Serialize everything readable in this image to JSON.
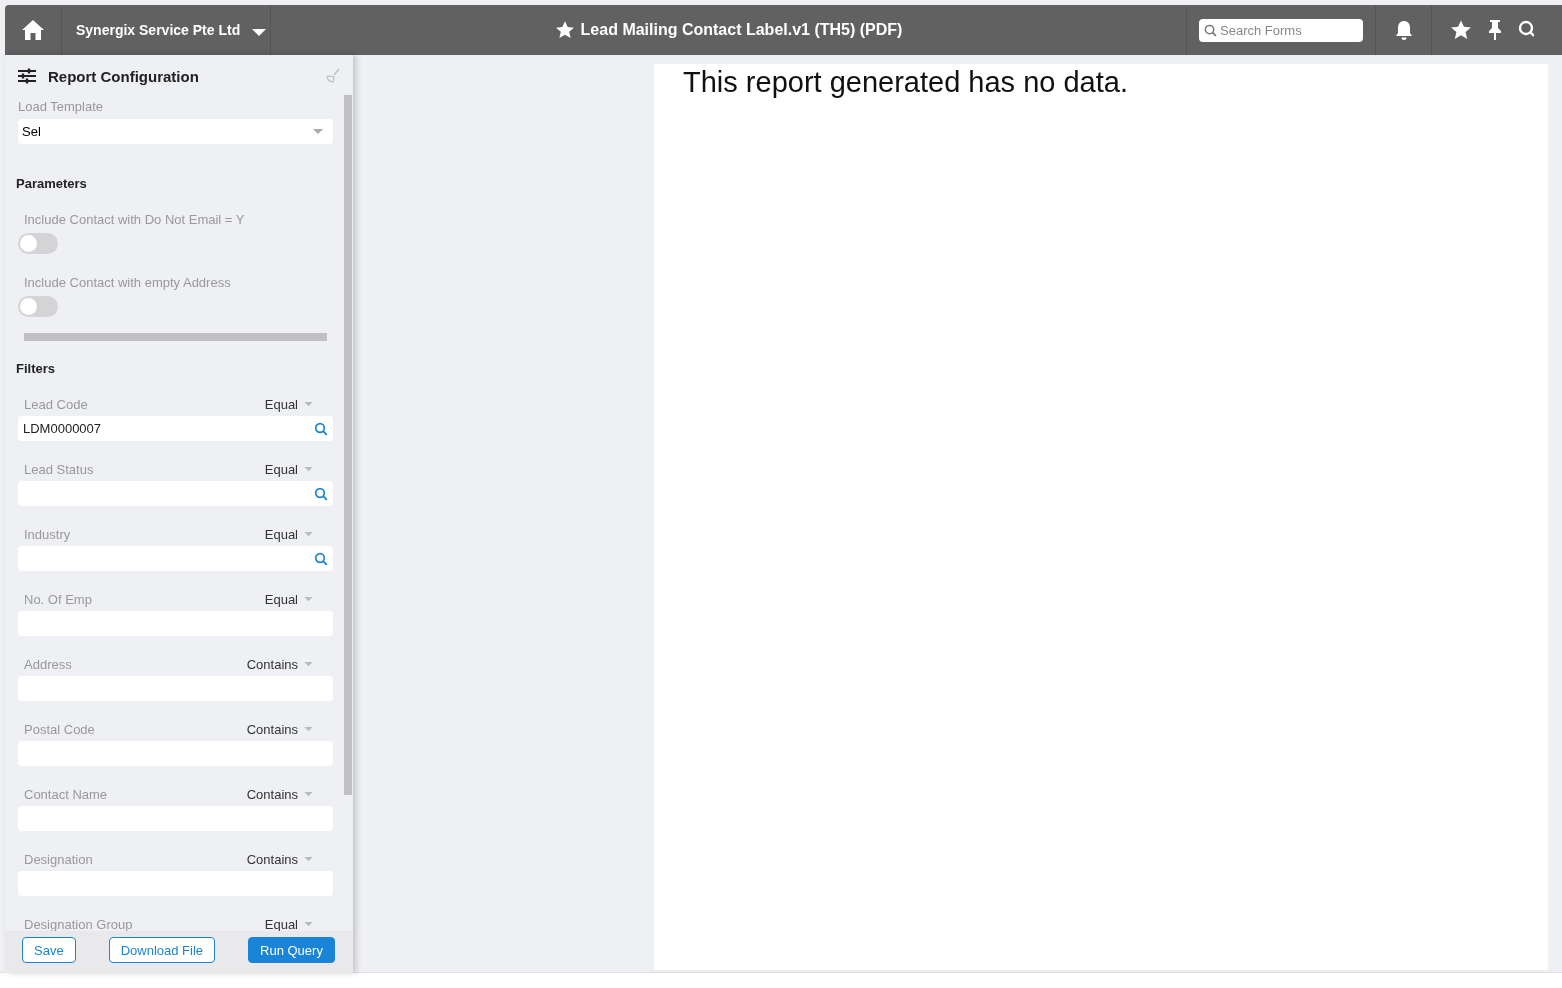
{
  "header": {
    "company": "Synergix Service Pte Ltd",
    "title": "Lead Mailing Contact Label.v1 (TH5) (PDF)",
    "search": {
      "placeholder": "Search Forms"
    }
  },
  "panel": {
    "title": "Report Configuration",
    "template": {
      "label": "Load Template",
      "value": "Sel"
    },
    "parameters_heading": "Parameters",
    "parameters": [
      {
        "label": "Include Contact with Do Not Email = Y",
        "on": false
      },
      {
        "label": "Include Contact with empty Address",
        "on": false
      }
    ],
    "filters_heading": "Filters",
    "filters": [
      {
        "label": "Lead Code",
        "operator": "Equal",
        "value": "LDM0000007",
        "lookup": true
      },
      {
        "label": "Lead Status",
        "operator": "Equal",
        "lookup": true
      },
      {
        "label": "Industry",
        "operator": "Equal",
        "lookup": true
      },
      {
        "label": "No. Of Emp",
        "operator": "Equal",
        "lookup": false
      },
      {
        "label": "Address",
        "operator": "Contains",
        "lookup": false
      },
      {
        "label": "Postal Code",
        "operator": "Contains",
        "lookup": false
      },
      {
        "label": "Contact Name",
        "operator": "Contains",
        "lookup": false
      },
      {
        "label": "Designation",
        "operator": "Contains",
        "lookup": false
      },
      {
        "label": "Designation Group",
        "operator": "Equal"
      }
    ],
    "buttons": [
      {
        "label": "Save",
        "kind": "outline"
      },
      {
        "label": "Download File",
        "kind": "outline"
      },
      {
        "label": "Run Query",
        "kind": "primary"
      }
    ]
  },
  "report": {
    "message": "This report generated has no data."
  }
}
